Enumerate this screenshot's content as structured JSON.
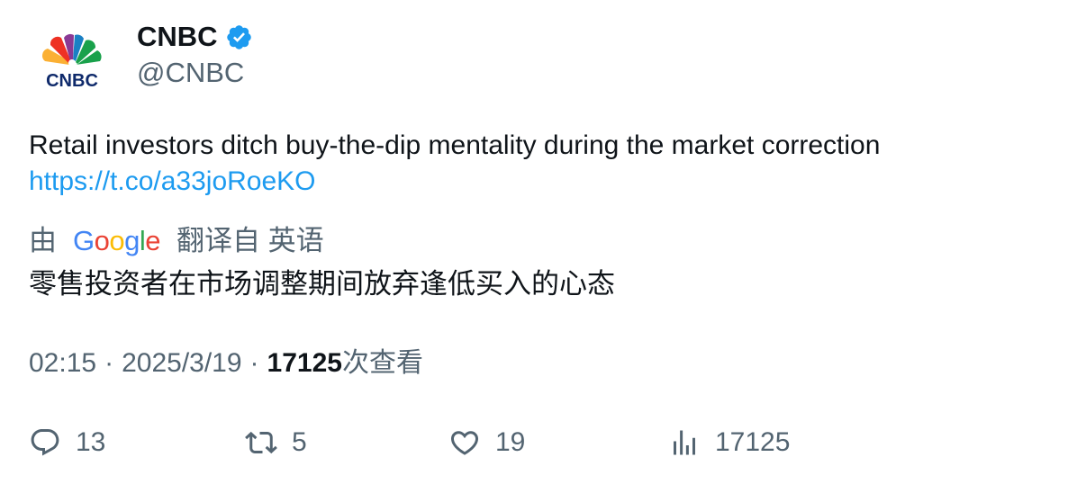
{
  "author": {
    "name": "CNBC",
    "handle": "@CNBC",
    "verified": true,
    "logo_text": "CNBC"
  },
  "tweet": {
    "text": "Retail investors ditch buy-the-dip mentality during the market correction",
    "link": "https://t.co/a33joRoeKO"
  },
  "translation": {
    "prefix": "由",
    "provider": "Google",
    "suffix": "翻译自 英语",
    "text": "零售投资者在市场调整期间放弃逢低买入的心态"
  },
  "meta": {
    "time": "02:15",
    "separator": "·",
    "date": "2025/3/19",
    "views_count": "17125",
    "views_label": "次查看"
  },
  "actions": {
    "replies": "13",
    "retweets": "5",
    "likes": "19",
    "views": "17125"
  },
  "colors": {
    "text_primary": "#0f1419",
    "text_secondary": "#536471",
    "link": "#1d9bf0",
    "verified_badge": "#1d9bf0"
  }
}
